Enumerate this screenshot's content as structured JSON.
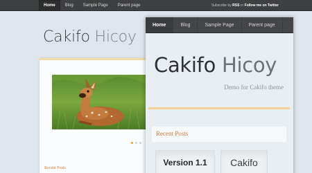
{
  "background_site": {
    "nav": [
      "Home",
      "Blog",
      "Sample Page",
      "Parent page"
    ],
    "subscribe": {
      "prefix": "Subscribe by",
      "rss": "RSS",
      "or": "or",
      "twitter": "Follow me on Twitter"
    },
    "title_primary": "Cakifo",
    "title_secondary": "Hicoy",
    "recent_label": "Recent Posts",
    "slider": {
      "active_index": 0,
      "count": 3
    }
  },
  "preview": {
    "nav": [
      "Home",
      "Blog",
      "Sample Page",
      "Parent page"
    ],
    "title_primary": "Cakifo",
    "title_secondary": "Hicoy",
    "tagline": "Demo for Cakifo theme",
    "recent_label": "Recent Posts",
    "thumb1_text": "Version 1.1",
    "thumb2_text": "Cakifo"
  },
  "colors": {
    "accent_orange": "#d47b3c",
    "rule_gold": "#f1d19a",
    "nav_bg": "#444548"
  }
}
